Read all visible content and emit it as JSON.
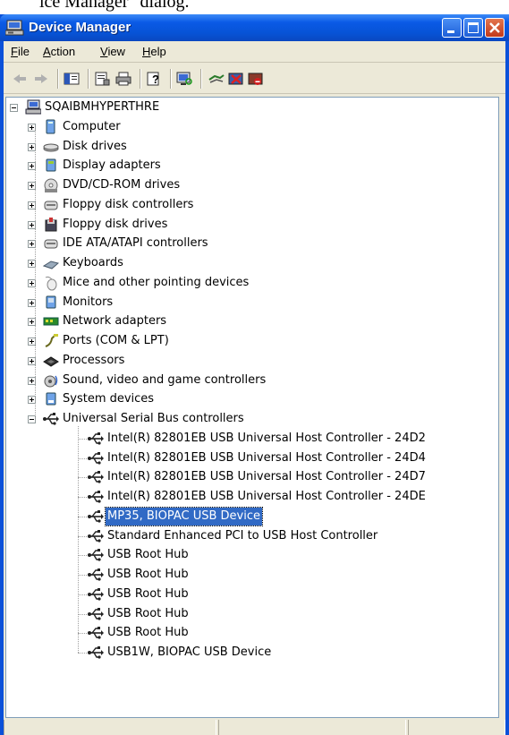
{
  "doc_fragment": "ice Manager\" dialog.",
  "window": {
    "title": "Device Manager",
    "icon": "device-manager-icon"
  },
  "menu": [
    {
      "label": "File",
      "mnemonic": "F",
      "rest": "ile"
    },
    {
      "label": "Action",
      "mnemonic": "A",
      "rest": "ction"
    },
    {
      "label": "View",
      "mnemonic": "V",
      "rest": "iew"
    },
    {
      "label": "Help",
      "mnemonic": "H",
      "rest": "elp"
    }
  ],
  "toolbar": {
    "buttons": [
      "back-arrow-icon",
      "forward-arrow-icon",
      "show-hide-tree-icon",
      "properties-icon",
      "print-icon",
      "help-icon",
      "scan-hardware-icon",
      "update-driver-icon",
      "uninstall-icon",
      "disable-icon"
    ]
  },
  "tree": {
    "root": "SQAIBMHYPERTHRE",
    "categories": [
      {
        "label": "Computer",
        "icon": "computer-icon"
      },
      {
        "label": "Disk drives",
        "icon": "disk-drive-icon"
      },
      {
        "label": "Display adapters",
        "icon": "display-adapter-icon"
      },
      {
        "label": "DVD/CD-ROM drives",
        "icon": "cd-rom-icon"
      },
      {
        "label": "Floppy disk controllers",
        "icon": "controller-icon"
      },
      {
        "label": "Floppy disk drives",
        "icon": "floppy-icon"
      },
      {
        "label": "IDE ATA/ATAPI controllers",
        "icon": "controller-icon"
      },
      {
        "label": "Keyboards",
        "icon": "keyboard-icon"
      },
      {
        "label": "Mice and other pointing devices",
        "icon": "mouse-icon"
      },
      {
        "label": "Monitors",
        "icon": "monitor-icon"
      },
      {
        "label": "Network adapters",
        "icon": "network-adapter-icon"
      },
      {
        "label": "Ports (COM & LPT)",
        "icon": "port-icon"
      },
      {
        "label": "Processors",
        "icon": "processor-icon"
      },
      {
        "label": "Sound, video and game controllers",
        "icon": "sound-icon"
      },
      {
        "label": "System devices",
        "icon": "system-icon"
      }
    ],
    "usb_category": "Universal Serial Bus controllers",
    "usb_devices": [
      "Intel(R) 82801EB USB Universal Host Controller - 24D2",
      "Intel(R) 82801EB USB Universal Host Controller - 24D4",
      "Intel(R) 82801EB USB Universal Host Controller - 24D7",
      "Intel(R) 82801EB USB Universal Host Controller - 24DE",
      "MP35, BIOPAC USB Device",
      "Standard Enhanced PCI to USB Host Controller",
      "USB Root Hub",
      "USB Root Hub",
      "USB Root Hub",
      "USB Root Hub",
      "USB Root Hub",
      "USB1W, BIOPAC USB Device"
    ],
    "selected_device": "MP35, BIOPAC USB Device"
  },
  "colors": {
    "title_bar": "#0a5ae6",
    "selection": "#316ac5",
    "dialog_face": "#ece9d8"
  }
}
